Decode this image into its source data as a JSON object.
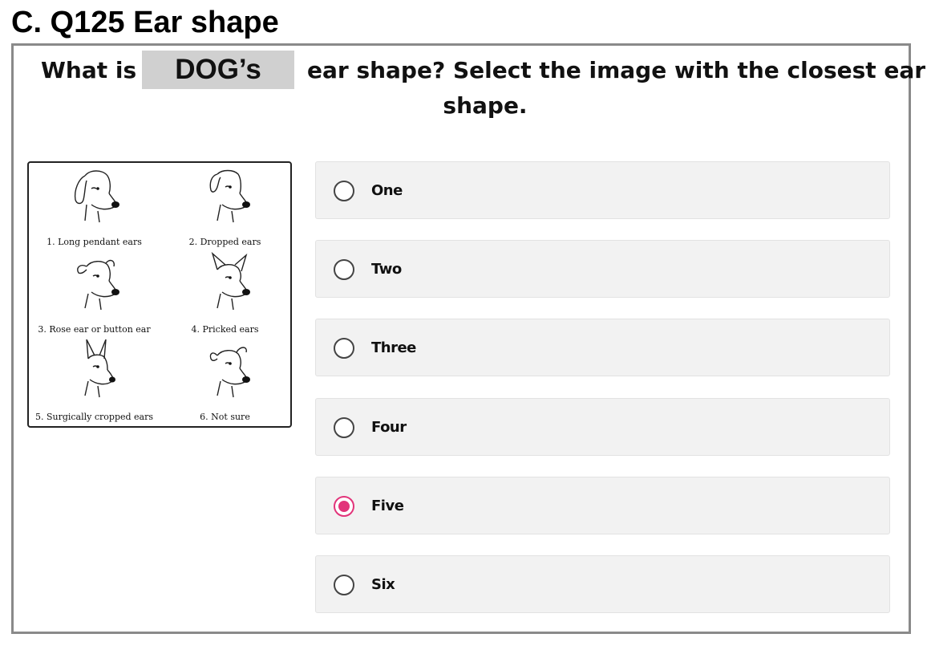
{
  "section": {
    "title": "C. Q125 Ear shape"
  },
  "question": {
    "prefix": "What is",
    "subject": "DOG’s",
    "suffix_line1": "ear shape? Select the image with the closest ear",
    "suffix_line2": "shape."
  },
  "reference_image": {
    "captions": [
      "1. Long pendant ears",
      "2. Dropped ears",
      "3. Rose ear or button ear",
      "4. Pricked ears",
      "5. Surgically cropped ears",
      "6. Not sure"
    ]
  },
  "options": [
    {
      "label": "One",
      "selected": false
    },
    {
      "label": "Two",
      "selected": false
    },
    {
      "label": "Three",
      "selected": false
    },
    {
      "label": "Four",
      "selected": false
    },
    {
      "label": "Five",
      "selected": true
    },
    {
      "label": "Six",
      "selected": false
    }
  ],
  "colors": {
    "accent": "#e2347a",
    "option_bg": "#f2f2f2",
    "frame_border": "#8a8a8a",
    "subject_bg": "#d0d0d0"
  }
}
